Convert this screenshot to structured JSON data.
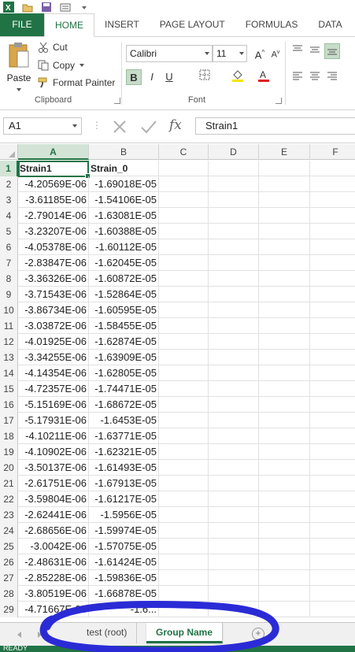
{
  "ribbon": {
    "tabs": [
      "FILE",
      "HOME",
      "INSERT",
      "PAGE LAYOUT",
      "FORMULAS",
      "DATA"
    ],
    "active_tab": "HOME",
    "clipboard": {
      "paste": "Paste",
      "cut": "Cut",
      "copy": "Copy",
      "format_painter": "Format Painter",
      "label": "Clipboard"
    },
    "font": {
      "name": "Calibri",
      "size": "11",
      "label": "Font",
      "bold": "B",
      "italic": "I",
      "underline": "U"
    }
  },
  "formula_bar": {
    "name_box": "A1",
    "fx": "fx",
    "content": "Strain1"
  },
  "grid": {
    "columns": [
      "A",
      "B",
      "C",
      "D",
      "E",
      "F"
    ],
    "header_row": [
      "Strain1",
      "Strain_0"
    ],
    "rows": [
      [
        "-4.20569E-06",
        "-1.69018E-05"
      ],
      [
        "-3.61185E-06",
        "-1.54106E-05"
      ],
      [
        "-2.79014E-06",
        "-1.63081E-05"
      ],
      [
        "-3.23207E-06",
        "-1.60388E-05"
      ],
      [
        "-4.05378E-06",
        "-1.60112E-05"
      ],
      [
        "-2.83847E-06",
        "-1.62045E-05"
      ],
      [
        "-3.36326E-06",
        "-1.60872E-05"
      ],
      [
        "-3.71543E-06",
        "-1.52864E-05"
      ],
      [
        "-3.86734E-06",
        "-1.60595E-05"
      ],
      [
        "-3.03872E-06",
        "-1.58455E-05"
      ],
      [
        "-4.01925E-06",
        "-1.62874E-05"
      ],
      [
        "-3.34255E-06",
        "-1.63909E-05"
      ],
      [
        "-4.14354E-06",
        "-1.62805E-05"
      ],
      [
        "-4.72357E-06",
        "-1.74471E-05"
      ],
      [
        "-5.15169E-06",
        "-1.68672E-05"
      ],
      [
        "-5.17931E-06",
        "-1.6453E-05"
      ],
      [
        "-4.10211E-06",
        "-1.63771E-05"
      ],
      [
        "-4.10902E-06",
        "-1.62321E-05"
      ],
      [
        "-3.50137E-06",
        "-1.61493E-05"
      ],
      [
        "-2.61751E-06",
        "-1.67913E-05"
      ],
      [
        "-3.59804E-06",
        "-1.61217E-05"
      ],
      [
        "-2.62441E-06",
        "-1.5956E-05"
      ],
      [
        "-2.68656E-06",
        "-1.59974E-05"
      ],
      [
        "-3.0042E-06",
        "-1.57075E-05"
      ],
      [
        "-2.48631E-06",
        "-1.61424E-05"
      ],
      [
        "-2.85228E-06",
        "-1.59836E-05"
      ],
      [
        "-3.80519E-06",
        "-1.66878E-05"
      ],
      [
        "-4.71667E-06",
        "-1.6..."
      ]
    ]
  },
  "sheets": {
    "tabs": [
      "test (root)",
      "Group Name"
    ],
    "active": "Group Name",
    "add": "+"
  },
  "status": "READY",
  "colors": {
    "accent": "#217346",
    "annotation": "#2b2bd6"
  }
}
